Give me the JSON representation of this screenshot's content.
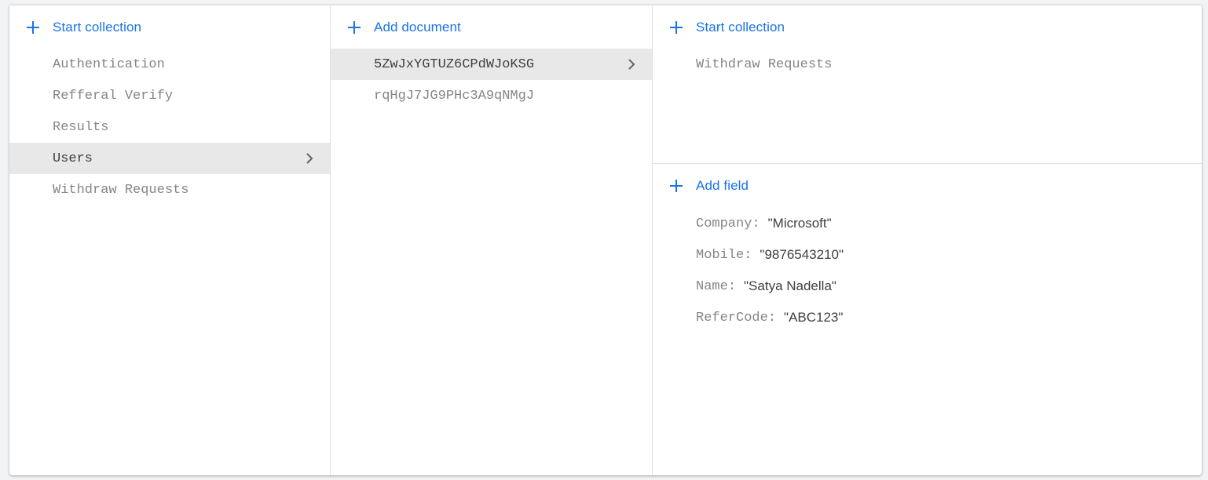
{
  "colors": {
    "accent": "#1a73e8",
    "muted_text": "#80868b",
    "dark_text": "#3c4043",
    "selected_bg": "#e8e8e8"
  },
  "col1": {
    "action_label": "Start collection",
    "action_icon": "plus-icon",
    "items": [
      {
        "label": "Authentication",
        "selected": false
      },
      {
        "label": "Refferal Verify",
        "selected": false
      },
      {
        "label": "Results",
        "selected": false
      },
      {
        "label": "Users",
        "selected": true
      },
      {
        "label": "Withdraw Requests",
        "selected": false
      }
    ]
  },
  "col2": {
    "action_label": "Add document",
    "action_icon": "plus-icon",
    "items": [
      {
        "label": "5ZwJxYGTUZ6CPdWJoKSG",
        "selected": true
      },
      {
        "label": "rqHgJ7JG9PHc3A9qNMgJ",
        "selected": false
      }
    ]
  },
  "col3": {
    "subcollections": {
      "action_label": "Start collection",
      "action_icon": "plus-icon",
      "items": [
        {
          "label": "Withdraw Requests"
        }
      ]
    },
    "fields": {
      "action_label": "Add field",
      "action_icon": "plus-icon",
      "items": [
        {
          "key": "Company",
          "value": "\"Microsoft\""
        },
        {
          "key": "Mobile",
          "value": "\"9876543210\""
        },
        {
          "key": "Name",
          "value": "\"Satya Nadella\""
        },
        {
          "key": "ReferCode",
          "value": "\"ABC123\""
        }
      ]
    }
  }
}
